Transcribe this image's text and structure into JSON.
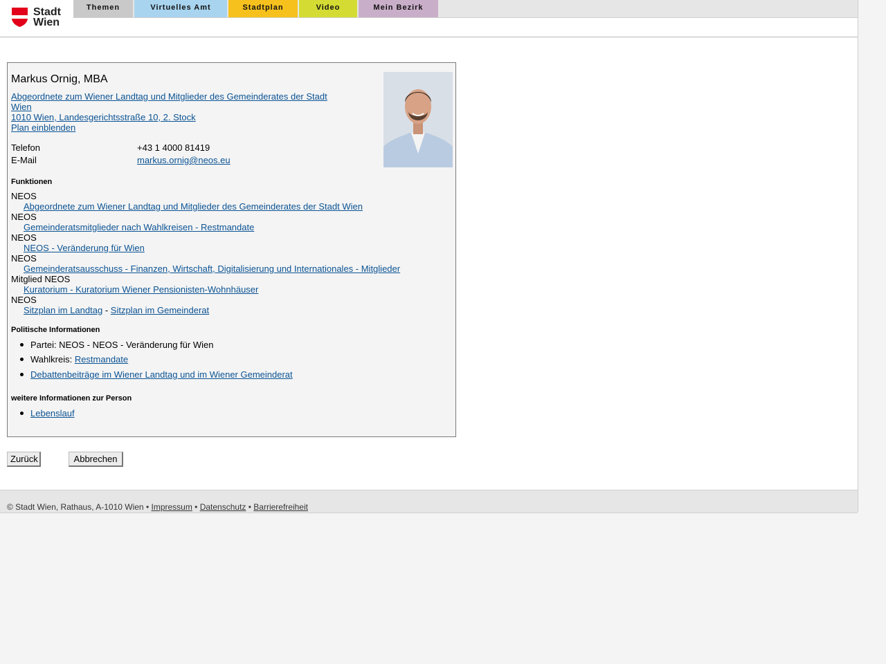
{
  "logo": {
    "line1": "Stadt",
    "line2": "Wien"
  },
  "nav": [
    {
      "label": "Themen",
      "color": "#c9c9c9"
    },
    {
      "label": "Virtuelles Amt",
      "color": "#a8d4ef"
    },
    {
      "label": "Stadtplan",
      "color": "#f7c11d"
    },
    {
      "label": "Video",
      "color": "#d4dc33"
    },
    {
      "label": "Mein Bezirk",
      "color": "#c9aec9"
    }
  ],
  "person": {
    "name": "Markus Ornig, MBA",
    "org_link_line1": "Abgeordnete zum Wiener Landtag und Mitglieder des Gemeinderates der Stadt",
    "org_link_line2": "Wien ",
    "address": "1010 Wien, Landesgerichtsstraße 10, 2. Stock",
    "plan_link": "Plan einblenden",
    "phone_label": "Telefon",
    "phone": "+43 1 4000 81419",
    "email_label": "E-Mail",
    "email": "markus.ornig@neos.eu"
  },
  "functions": {
    "heading": "Funktionen",
    "items": [
      {
        "role": "NEOS",
        "link": "Abgeordnete zum Wiener Landtag und Mitglieder des Gemeinderates der Stadt Wien"
      },
      {
        "role": "NEOS",
        "link": "Gemeinderatsmitglieder nach Wahlkreisen - Restmandate"
      },
      {
        "role": "NEOS",
        "link": "NEOS - Veränderung für Wien"
      },
      {
        "role": "NEOS",
        "link": "Gemeinderatsausschuss - Finanzen, Wirtschaft, Digitalisierung und Internationales - Mitglieder"
      },
      {
        "role": "Mitglied NEOS",
        "link": "Kuratorium - Kuratorium Wiener Pensionisten-Wohnhäuser"
      },
      {
        "role": "NEOS",
        "link_a": "Sitzplan im Landtag",
        "separator": "-",
        "link_b": "Sitzplan im Gemeinderat"
      }
    ]
  },
  "political": {
    "heading": "Politische Informationen",
    "party": "Partei: NEOS - NEOS - Veränderung für Wien",
    "district_label": "Wahlkreis: ",
    "district_link": "Restmandate",
    "debate_link": "Debattenbeiträge im Wiener Landtag und im Wiener Gemeinderat"
  },
  "more": {
    "heading": "weitere Informationen zur Person",
    "cv_link": "Lebenslauf"
  },
  "buttons": {
    "back": "Zurück",
    "cancel": "Abbrechen"
  },
  "footer": {
    "copyright": "© Stadt Wien, Rathaus, A-1010 Wien • ",
    "impressum": "Impressum",
    "sep1": " • ",
    "privacy": "Datenschutz",
    "sep2": " • ",
    "accessibility": "Barrierefreiheit"
  }
}
